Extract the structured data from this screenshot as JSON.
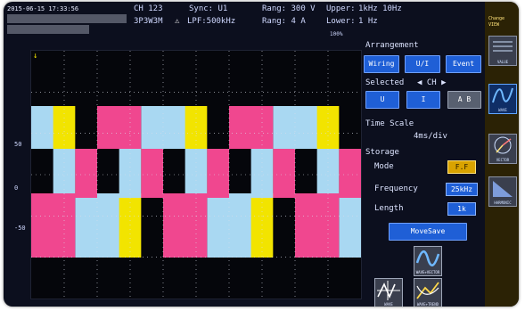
{
  "status": {
    "date": "2015-06-15 17:33:56",
    "ch": "CH 123",
    "wiring": "3P3W3M",
    "sync": "Sync: U1",
    "lpf": "LPF:500kHz",
    "range_u": "Rang: 300 V",
    "range_i": "Rang:   4 A",
    "upper": "Upper:",
    "upper_val": "1kHz  10Hz",
    "lower": "Lower:",
    "lower_val": "1 Hz",
    "scale_tag": "100%"
  },
  "scope": {
    "y_labels": [
      "50",
      "0",
      "-50"
    ],
    "colors": {
      "yellow": "#f2e400",
      "blue": "#a9d8f2",
      "pink": "#f0478f"
    }
  },
  "panel": {
    "arrangement_label": "Arrangement",
    "wiring_btn": "Wiring",
    "ui_btn": "U/I",
    "event_btn": "Event",
    "selected_label": "Selected",
    "selected_ch": "◀  CH  ▶",
    "u_btn": "U",
    "i_btn": "I",
    "ab_btn": "A B",
    "time_scale_label": "Time Scale",
    "time_scale_value": "4ms/div",
    "storage_label": "Storage",
    "mode_label": "Mode",
    "mode_value": "F.F",
    "frequency_label": "Frequency",
    "frequency_value": "25kHz",
    "length_label": "Length",
    "length_value": "1k",
    "move_btn": "MoveSave",
    "view_icons": [
      "WAVE+VECTOR",
      "WAVE",
      "WAVE+TREND"
    ]
  },
  "sidebar": {
    "top_label": "Change\nVIEW",
    "items": [
      "VALUE",
      "WAVE",
      "VECTOR",
      "HARMONIC"
    ]
  }
}
